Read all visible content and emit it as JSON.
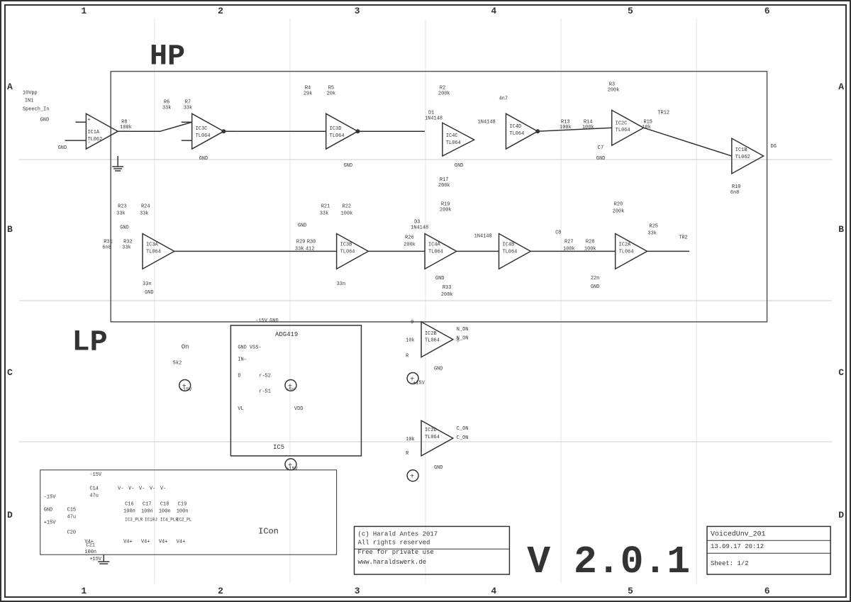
{
  "schematic": {
    "title": "VoicedUnv_201",
    "version": "V 2.0.1",
    "date": "13.09.17 20:12",
    "sheet": "Sheet: 1/2",
    "copyright_lines": [
      "(c) Harald Antes 2017",
      "All rights reserved",
      "Free for private use",
      "www.haraldswerk.de"
    ],
    "sections": {
      "hp_label": "HP",
      "lp_label": "LP"
    },
    "grid": {
      "columns": [
        "1",
        "2",
        "3",
        "4",
        "5",
        "6"
      ],
      "rows": [
        "A",
        "B",
        "C",
        "D"
      ]
    },
    "components": {
      "ic1a": "IC1A\nTL062",
      "ic1b": "IC1B\nTL062",
      "ic2a": "IC2A\nTL064",
      "ic2b": "IC2B\nTL064",
      "ic2c": "IC2C\nTL064",
      "ic2d": "IC2D\nTL064",
      "ic3a": "IC3A\nTL064",
      "ic3b": "IC3B\nTL064",
      "ic3c": "IC3C\nTL064",
      "ic3d": "IC3D\nTL064",
      "ic4a": "IC4A\nTL064",
      "ic4b": "IC4B\nTL064",
      "ic4c": "IC4C\nTL064",
      "ic4d": "IC4D\nTL064",
      "ic5": "IC5\nADG419",
      "icon": "ICon"
    }
  }
}
